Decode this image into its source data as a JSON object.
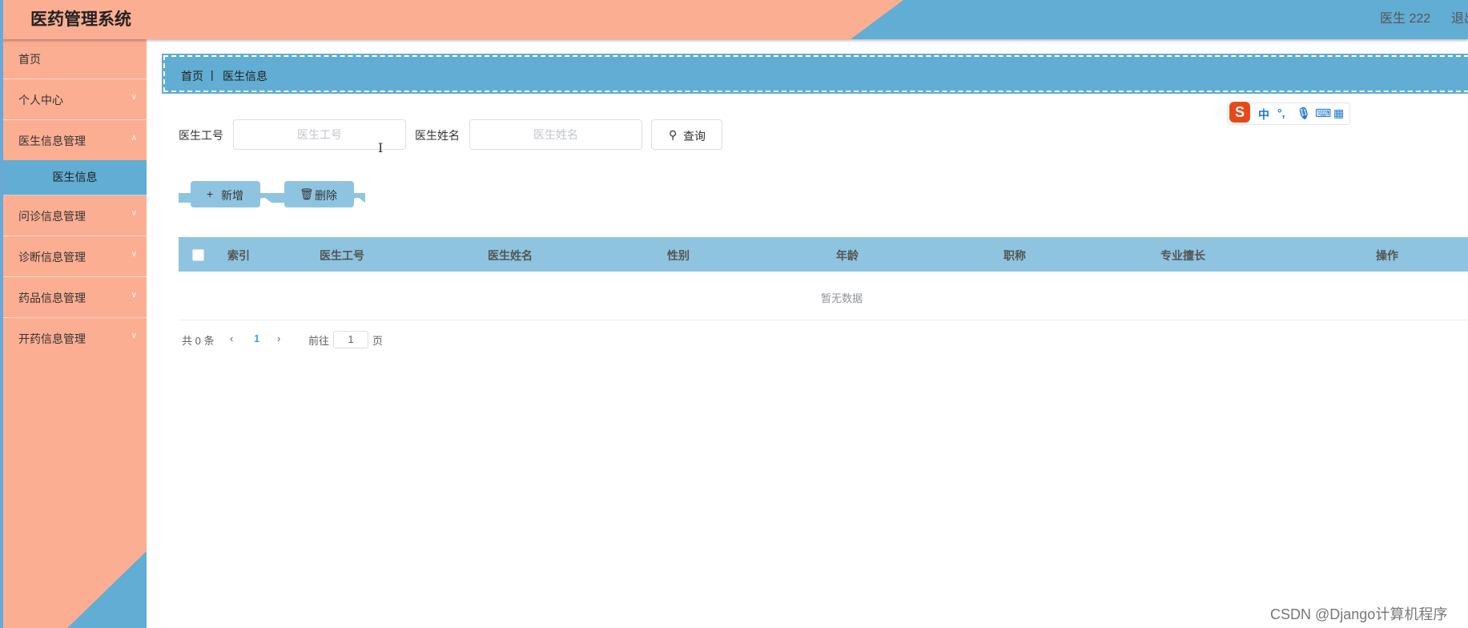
{
  "header": {
    "title": "医药管理系统",
    "user": "医生 222",
    "logout": "退出"
  },
  "sidebar": {
    "items": [
      {
        "label": "首页"
      },
      {
        "label": "个人中心"
      },
      {
        "label": "医生信息管理"
      },
      {
        "label": "医生信息"
      },
      {
        "label": "问诊信息管理"
      },
      {
        "label": "诊断信息管理"
      },
      {
        "label": "药品信息管理"
      },
      {
        "label": "开药信息管理"
      }
    ]
  },
  "breadcrumb": {
    "home": "首页",
    "separator": "|",
    "current": "医生信息"
  },
  "search": {
    "doctor_id_label": "医生工号",
    "doctor_id_placeholder": "医生工号",
    "doctor_name_label": "医生姓名",
    "doctor_name_placeholder": "医生姓名",
    "query_label": "查询"
  },
  "ime": {
    "lang": "中"
  },
  "actions": {
    "add_label": "新增",
    "delete_label": "删除"
  },
  "table": {
    "columns": [
      "索引",
      "医生工号",
      "医生姓名",
      "性别",
      "年龄",
      "职称",
      "专业擅长",
      "操作"
    ],
    "empty_text": "暂无数据"
  },
  "pagination": {
    "total": "共 0 条",
    "page": "1",
    "goto": "前往",
    "page_input": "1",
    "page_suffix": "页"
  },
  "watermark": "CSDN @Django计算机程序",
  "colors": {
    "salmon": "#fcae92",
    "blue": "#61add3",
    "light_blue": "#8ec4df"
  }
}
